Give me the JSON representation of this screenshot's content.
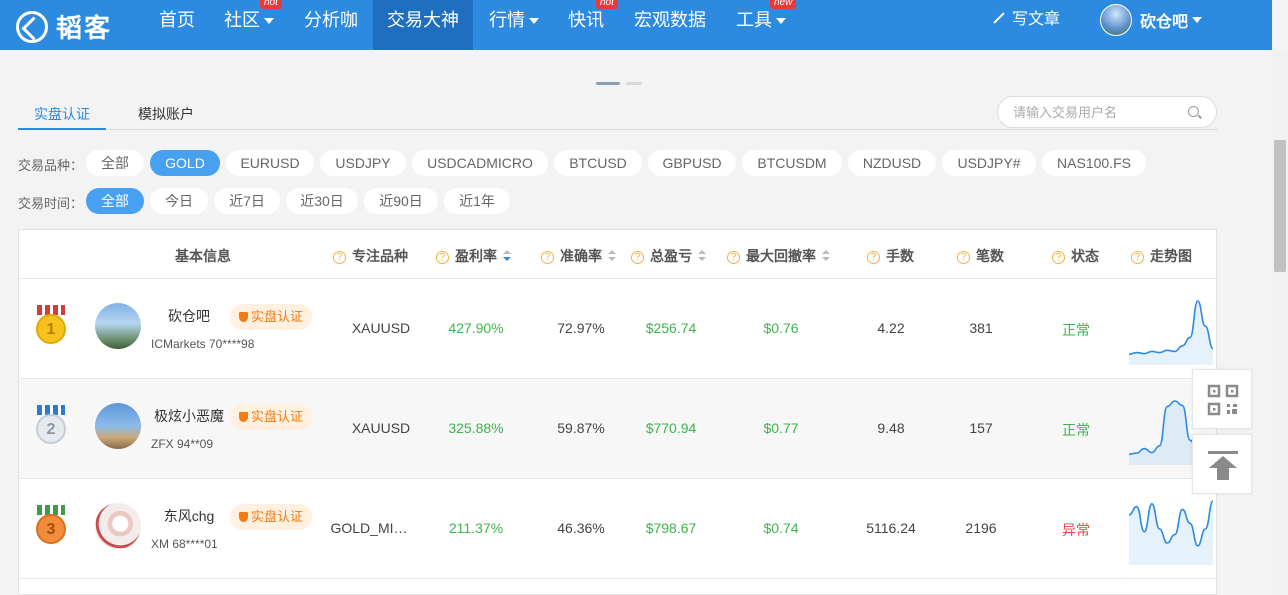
{
  "header": {
    "logo_text": "韬客",
    "nav": [
      {
        "label": "首页",
        "has_caret": false,
        "badge": ""
      },
      {
        "label": "社区",
        "has_caret": true,
        "badge": "hot"
      },
      {
        "label": "分析咖",
        "has_caret": false,
        "badge": ""
      },
      {
        "label": "交易大神",
        "has_caret": false,
        "badge": "",
        "active": true
      },
      {
        "label": "行情",
        "has_caret": true,
        "badge": ""
      },
      {
        "label": "快讯",
        "has_caret": false,
        "badge": "hot"
      },
      {
        "label": "宏观数据",
        "has_caret": false,
        "badge": ""
      },
      {
        "label": "工具",
        "has_caret": true,
        "badge": "new"
      }
    ],
    "write_label": "写文章",
    "username": "砍仓吧"
  },
  "tabs": [
    {
      "label": "实盘认证",
      "active": true
    },
    {
      "label": "模拟账户",
      "active": false
    }
  ],
  "search": {
    "placeholder": "请输入交易用户名"
  },
  "filters": {
    "symbol_label": "交易品种：",
    "symbols": [
      "全部",
      "GOLD",
      "EURUSD",
      "USDJPY",
      "USDCADMICRO",
      "BTCUSD",
      "GBPUSD",
      "BTCUSDM",
      "NZDUSD",
      "USDJPY#",
      "NAS100.FS"
    ],
    "symbol_selected": "GOLD",
    "time_label": "交易时间：",
    "times": [
      "全部",
      "今日",
      "近7日",
      "近30日",
      "近90日",
      "近1年"
    ],
    "time_selected": "全部"
  },
  "table": {
    "columns": {
      "basic": "基本信息",
      "focus": "专注品种",
      "profit_rate": "盈利率",
      "accuracy": "准确率",
      "total_profit": "总盈亏",
      "max_drawdown": "最大回撤率",
      "lots": "手数",
      "trades": "笔数",
      "status": "状态",
      "trend": "走势图"
    },
    "rows": [
      {
        "rank": "1",
        "name": "砍仓吧",
        "cert": "实盘认证",
        "broker": "ICMarkets 70****98",
        "symbol": "XAUUSD",
        "profit_rate": "427.90%",
        "accuracy": "72.97%",
        "total_profit": "$256.74",
        "max_drawdown": "$0.76",
        "lots": "4.22",
        "trades": "381",
        "status": "正常",
        "status_color": "#3cb54a",
        "trend": [
          0.05,
          0.08,
          0.06,
          0.1,
          0.08,
          0.12,
          0.1,
          0.2,
          0.35,
          1.0,
          0.55,
          0.15
        ]
      },
      {
        "rank": "2",
        "name": "极炫小恶魔",
        "cert": "实盘认证",
        "broker": "ZFX 94**09",
        "symbol": "XAUUSD",
        "profit_rate": "325.88%",
        "accuracy": "59.87%",
        "total_profit": "$770.94",
        "max_drawdown": "$0.77",
        "lots": "9.48",
        "trades": "157",
        "status": "正常",
        "status_color": "#3cb54a",
        "trend": [
          0.05,
          0.07,
          0.15,
          0.08,
          0.2,
          0.9,
          1.0,
          0.92,
          0.3,
          0.1,
          0.12,
          0.1
        ]
      },
      {
        "rank": "3",
        "name": "东风chg",
        "cert": "实盘认证",
        "broker": "XM 68****01",
        "symbol": "GOLD_MI…",
        "profit_rate": "211.37%",
        "accuracy": "46.36%",
        "total_profit": "$798.67",
        "max_drawdown": "$0.74",
        "lots": "5116.24",
        "trades": "2196",
        "status": "异常",
        "status_color": "#e64a4a",
        "trend": [
          0.75,
          0.9,
          0.45,
          0.95,
          0.5,
          0.25,
          0.4,
          0.85,
          0.6,
          0.2,
          0.5,
          1.0
        ]
      }
    ]
  },
  "icons": {
    "qr": "qr-code-icon",
    "top": "back-to-top-icon"
  },
  "colors": {
    "primary": "#2c8be0",
    "nav_active": "#1f6fc0",
    "chip_selected": "#47a0f0",
    "positive": "#3cb54a",
    "negative": "#e64a4a",
    "badge": "#e93a3a"
  }
}
